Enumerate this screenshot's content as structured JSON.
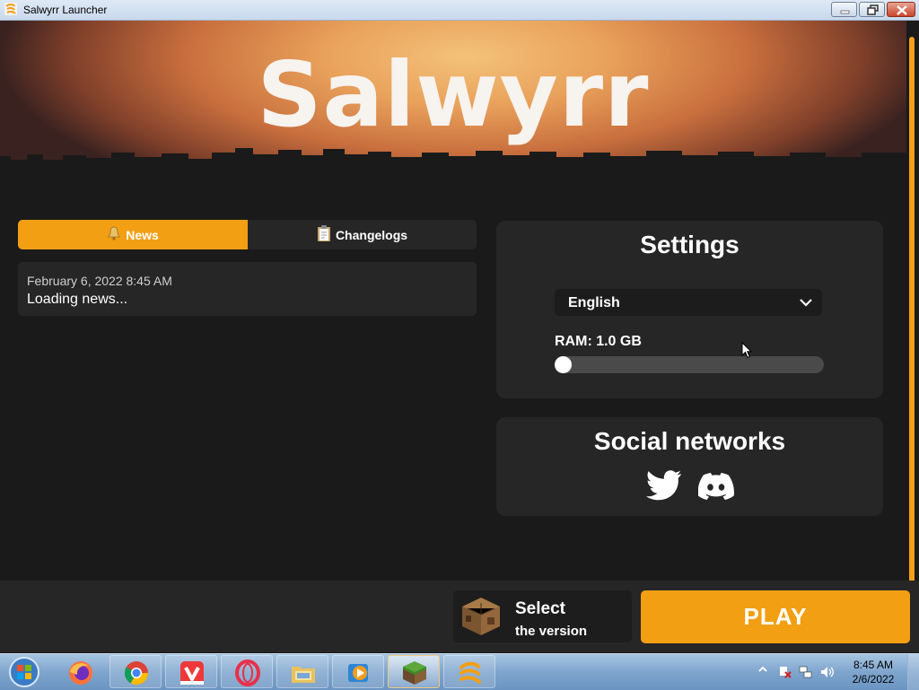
{
  "window": {
    "title": "Salwyrr Launcher"
  },
  "header": {
    "logo_text": "Salwyrr"
  },
  "tabs": [
    {
      "label": "News",
      "icon": "bell-icon",
      "active": true
    },
    {
      "label": "Changelogs",
      "icon": "clipboard-icon",
      "active": false
    }
  ],
  "news": {
    "date": "February 6, 2022 8:45 AM",
    "body": "Loading news..."
  },
  "settings": {
    "title": "Settings",
    "language": {
      "selected": "English"
    },
    "ram": {
      "label": "RAM: 1.0 GB",
      "level_fraction": 0
    }
  },
  "social": {
    "title": "Social networks",
    "links": [
      {
        "icon": "twitter-icon"
      },
      {
        "icon": "discord-icon"
      }
    ]
  },
  "version": {
    "line1": "Select",
    "line2": "the version",
    "icon": "crafting-table-icon"
  },
  "play": {
    "label": "PLAY"
  },
  "colors": {
    "accent": "#f29f13",
    "panel": "#262626",
    "background": "#1a1a1a"
  },
  "taskbar": {
    "apps": [
      "firefox-icon",
      "chrome-icon",
      "vivaldi-icon",
      "opera-icon",
      "file-explorer-icon",
      "media-player-icon",
      "minecraft-icon",
      "salwyrr-icon"
    ],
    "clock": {
      "time": "8:45 AM",
      "date": "2/6/2022"
    }
  }
}
